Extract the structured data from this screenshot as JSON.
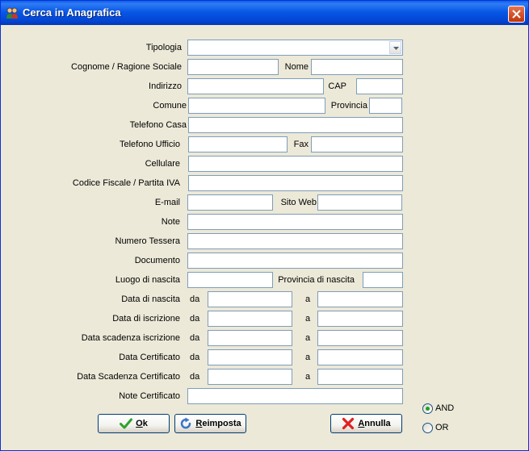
{
  "window": {
    "title": "Cerca in Anagrafica"
  },
  "fields": {
    "tipologia": {
      "label": "Tipologia",
      "value": ""
    },
    "cognome": {
      "label": "Cognome / Ragione Sociale",
      "value": ""
    },
    "nome": {
      "label": "Nome",
      "value": ""
    },
    "indirizzo": {
      "label": "Indirizzo",
      "value": ""
    },
    "cap": {
      "label": "CAP",
      "value": ""
    },
    "comune": {
      "label": "Comune",
      "value": ""
    },
    "provincia": {
      "label": "Provincia",
      "value": ""
    },
    "telefono_casa": {
      "label": "Telefono Casa",
      "value": ""
    },
    "telefono_ufficio": {
      "label": "Telefono Ufficio",
      "value": ""
    },
    "fax": {
      "label": "Fax",
      "value": ""
    },
    "cellulare": {
      "label": "Cellulare",
      "value": ""
    },
    "codice_fiscale": {
      "label": "Codice Fiscale / Partita IVA",
      "value": ""
    },
    "email": {
      "label": "E-mail",
      "value": ""
    },
    "sito_web": {
      "label": "Sito Web",
      "value": ""
    },
    "note": {
      "label": "Note",
      "value": ""
    },
    "numero_tessera": {
      "label": "Numero Tessera",
      "value": ""
    },
    "documento": {
      "label": "Documento",
      "value": ""
    },
    "luogo_nascita": {
      "label": "Luogo di nascita",
      "value": ""
    },
    "provincia_nascita": {
      "label": "Provincia di nascita",
      "value": ""
    },
    "note_certificato": {
      "label": "Note Certificato",
      "value": ""
    }
  },
  "ranges": {
    "da_label": "da",
    "a_label": "a",
    "data_nascita": {
      "label": "Data di nascita",
      "from": "",
      "to": ""
    },
    "data_iscrizione": {
      "label": "Data di iscrizione",
      "from": "",
      "to": ""
    },
    "data_scadenza_iscrizione": {
      "label": "Data scadenza iscrizione",
      "from": "",
      "to": ""
    },
    "data_certificato": {
      "label": "Data Certificato",
      "from": "",
      "to": ""
    },
    "data_scadenza_certificato": {
      "label": "Data Scadenza Certificato",
      "from": "",
      "to": ""
    }
  },
  "logic": {
    "and_label": "AND",
    "or_label": "OR",
    "selected": "AND"
  },
  "buttons": {
    "ok": "Ok",
    "reimposta": "Reimposta",
    "annulla": "Annulla"
  },
  "colors": {
    "title_bar": "#0A5FEA",
    "close_button": "#C2350B",
    "window_bg": "#ECE9D8",
    "field_border": "#7F9DB9",
    "ok_check": "#2DA12D",
    "cancel_x": "#E02020",
    "reset_arrow": "#3A74C9"
  }
}
